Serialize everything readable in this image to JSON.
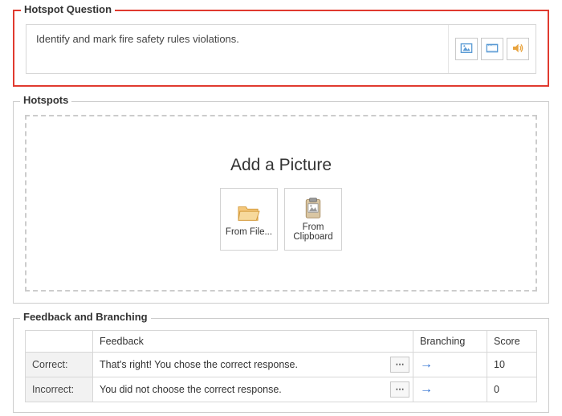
{
  "hotspot_question": {
    "title": "Hotspot Question",
    "text": "Identify and mark fire safety rules violations."
  },
  "hotspots": {
    "title": "Hotspots",
    "add_picture_title": "Add a Picture",
    "from_file_label": "From File...",
    "from_clipboard_label": "From Clipboard"
  },
  "feedback": {
    "title": "Feedback and Branching",
    "columns": {
      "feedback": "Feedback",
      "branching": "Branching",
      "score": "Score"
    },
    "rows": [
      {
        "label": "Correct:",
        "text": "That's right! You chose the correct response.",
        "branching": "→",
        "score": "10"
      },
      {
        "label": "Incorrect:",
        "text": "You did not choose the correct response.",
        "branching": "→",
        "score": "0"
      }
    ],
    "ellipsis": "⋯"
  }
}
